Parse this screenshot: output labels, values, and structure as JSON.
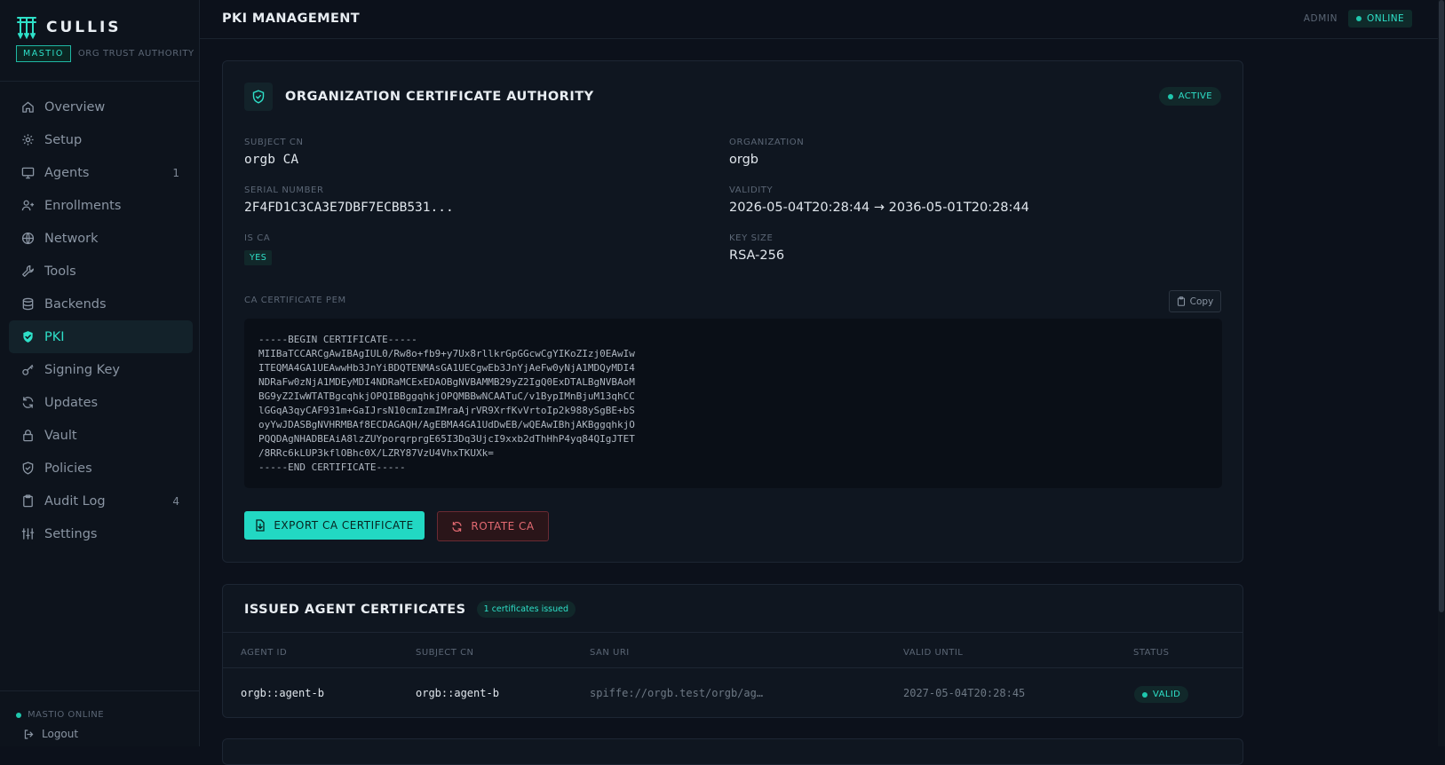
{
  "brand": {
    "name": "CULLIS",
    "tag": "MASTIO",
    "subtitle": "ORG TRUST AUTHORITY"
  },
  "sidebar": {
    "items": [
      {
        "label": "Overview",
        "icon": "home-icon",
        "count": ""
      },
      {
        "label": "Setup",
        "icon": "gear-icon",
        "count": ""
      },
      {
        "label": "Agents",
        "icon": "monitor-icon",
        "count": "1"
      },
      {
        "label": "Enrollments",
        "icon": "user-plus-icon",
        "count": ""
      },
      {
        "label": "Network",
        "icon": "globe-icon",
        "count": ""
      },
      {
        "label": "Tools",
        "icon": "wrench-icon",
        "count": ""
      },
      {
        "label": "Backends",
        "icon": "database-icon",
        "count": ""
      },
      {
        "label": "PKI",
        "icon": "shield-check-icon",
        "count": "",
        "active": true
      },
      {
        "label": "Signing Key",
        "icon": "key-icon",
        "count": ""
      },
      {
        "label": "Updates",
        "icon": "refresh-icon",
        "count": ""
      },
      {
        "label": "Vault",
        "icon": "lock-icon",
        "count": ""
      },
      {
        "label": "Policies",
        "icon": "shield-icon",
        "count": ""
      },
      {
        "label": "Audit Log",
        "icon": "clipboard-icon",
        "count": "4"
      },
      {
        "label": "Settings",
        "icon": "sliders-icon",
        "count": ""
      }
    ],
    "status": "MASTIO ONLINE",
    "logout": "Logout"
  },
  "header": {
    "title": "PKI MANAGEMENT",
    "user": "ADMIN",
    "status": "ONLINE"
  },
  "ca": {
    "title": "ORGANIZATION CERTIFICATE AUTHORITY",
    "status": "ACTIVE",
    "subject_cn_label": "SUBJECT CN",
    "subject_cn": "orgb CA",
    "organization_label": "ORGANIZATION",
    "organization": "orgb",
    "serial_label": "SERIAL NUMBER",
    "serial": "2F4FD1C3CA3E7DBF7ECBB531...",
    "validity_label": "VALIDITY",
    "validity": "2026-05-04T20:28:44 → 2036-05-01T20:28:44",
    "is_ca_label": "IS CA",
    "is_ca": "YES",
    "key_size_label": "KEY SIZE",
    "key_size": "RSA-256",
    "pem_label": "CA CERTIFICATE PEM",
    "copy_label": "Copy",
    "pem_lines": [
      "-----BEGIN CERTIFICATE-----",
      "MIIBaTCCARCgAwIBAgIUL0/Rw8o+fb9+y7Ux8rllkrGpGGcwCgYIKoZIzj0EAwIw",
      "ITEQMA4GA1UEAwwHb3JnYiBDQTENMAsGA1UECgwEb3JnYjAeFw0yNjA1MDQyMDI4",
      "NDRaFw0zNjA1MDEyMDI4NDRaMCExEDAOBgNVBAMMB29yZ2IgQ0ExDTALBgNVBAoM",
      "BG9yZ2IwWTATBgcqhkjOPQIBBggqhkjOPQMBBwNCAATuC/v1BypIMnBjuM13qhCC",
      "lGGqA3qyCAF931m+GaIJrsN10cmIzmIMraAjrVR9XrfKvVrtoIp2k988ySgBE+bS",
      "oyYwJDASBgNVHRMBAf8ECDAGAQH/AgEBMA4GA1UdDwEB/wQEAwIBhjAKBggqhkjO",
      "PQQDAgNHADBEAiA8lzZUYporqrprgE65I3Dq3UjcI9xxb2dThHhP4yq84QIgJTET",
      "/8RRc6kLUP3kflOBhc0X/LZRY87VzU4VhxTKUXk=",
      "-----END CERTIFICATE-----"
    ],
    "export_label": "EXPORT CA CERTIFICATE",
    "rotate_label": "ROTATE CA"
  },
  "issued": {
    "title": "ISSUED AGENT CERTIFICATES",
    "count_label": "1 certificates issued",
    "columns": [
      "AGENT ID",
      "SUBJECT CN",
      "SAN URI",
      "VALID UNTIL",
      "STATUS"
    ],
    "rows": [
      {
        "agent_id": "orgb::agent-b",
        "subject_cn": "orgb::agent-b",
        "san_uri": "spiffe://orgb.test/orgb/ag…",
        "valid_until": "2027-05-04T20:28:45",
        "status": "VALID"
      }
    ]
  },
  "colors": {
    "accent": "#22d8c3",
    "danger": "#e36a72",
    "background": "#0c111b",
    "card": "#0f1620"
  }
}
